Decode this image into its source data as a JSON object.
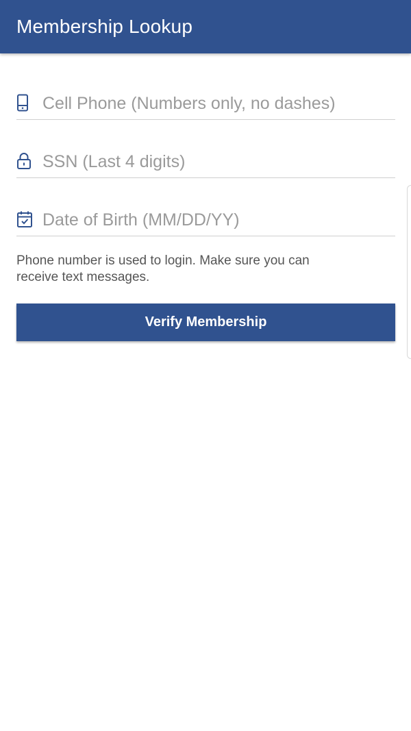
{
  "app_bar": {
    "title": "Membership Lookup"
  },
  "form": {
    "cell_phone": {
      "icon": "mobile-phone-icon",
      "value": "",
      "placeholder": "Cell Phone (Numbers only, no dashes)"
    },
    "ssn": {
      "icon": "lock-icon",
      "value": "",
      "placeholder": "SSN (Last 4 digits)"
    },
    "dob": {
      "icon": "calendar-icon",
      "value": "",
      "placeholder": "Date of Birth (MM/DD/YY)"
    },
    "helper_text": "Phone number is used to login. Make sure you can receive text messages.",
    "submit_label": "Verify Membership"
  },
  "colors": {
    "primary": "#30528f",
    "icon": "#30528f",
    "placeholder": "#9a9a9a",
    "divider": "#cfcfcf"
  }
}
